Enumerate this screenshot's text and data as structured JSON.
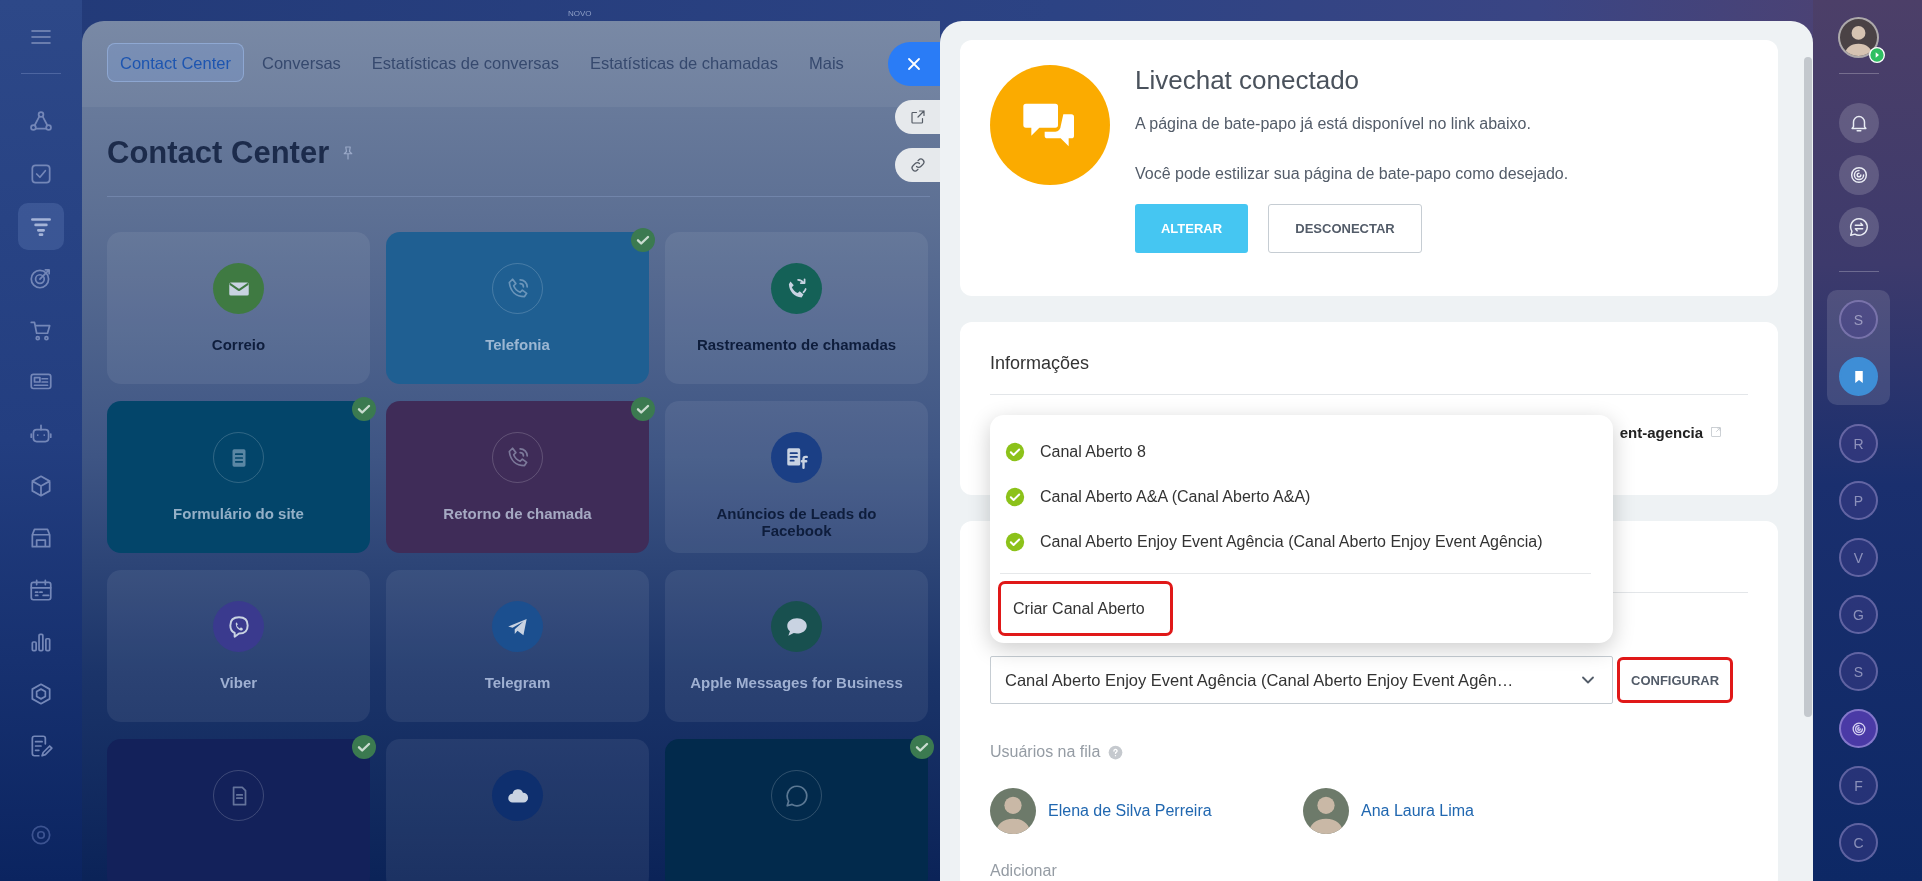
{
  "left_sidebar": {
    "items": [
      {
        "selected": false
      },
      {
        "selected": false
      },
      {
        "selected": true
      },
      {
        "selected": false
      },
      {
        "selected": false
      },
      {
        "selected": false
      },
      {
        "selected": false
      },
      {
        "selected": false
      },
      {
        "selected": false
      },
      {
        "selected": false
      },
      {
        "selected": false
      },
      {
        "selected": false
      },
      {
        "selected": false
      },
      {
        "selected": false
      }
    ]
  },
  "new_badge": "NOVO",
  "contact_center": {
    "tabs": [
      {
        "label": "Contact Center",
        "selected": true
      },
      {
        "label": "Conversas",
        "selected": false
      },
      {
        "label": "Estatísticas de conversas",
        "selected": false
      },
      {
        "label": "Estatísticas de chamadas",
        "selected": false
      },
      {
        "label": "Mais",
        "selected": false
      }
    ],
    "title": "Contact Center",
    "tiles": [
      {
        "label": "Correio",
        "kind": "plain",
        "checked": false,
        "color": "#3f7a42"
      },
      {
        "label": "Telefonia",
        "kind": "filled",
        "checked": true,
        "color": "#1f5f92"
      },
      {
        "label": "Rastreamento de chamadas",
        "kind": "plain",
        "checked": false,
        "color": "#146157"
      },
      {
        "label": "Formulário do site",
        "kind": "filled",
        "checked": true,
        "color": "#03456a"
      },
      {
        "label": "Retorno de chamada",
        "kind": "filled",
        "checked": true,
        "color": "#3f2c58"
      },
      {
        "label": "Anúncios de Leads do Facebook",
        "kind": "plain",
        "checked": false,
        "color": "#1b3f85"
      },
      {
        "label": "Viber",
        "kind": "plain",
        "checked": false,
        "color": "#3a3a8e"
      },
      {
        "label": "Telegram",
        "kind": "plain",
        "checked": false,
        "color": "#1b4f8f"
      },
      {
        "label": "Apple Messages for Business",
        "kind": "plain",
        "checked": false,
        "color": "#18504f"
      },
      {
        "kind": "filled",
        "checked": true,
        "color": "#13215a"
      },
      {
        "kind": "plain",
        "checked": false,
        "color": "#0e2f6e"
      },
      {
        "kind": "filled",
        "checked": true,
        "color": "#022a4c"
      }
    ]
  },
  "livechat": {
    "title": "Livechat conectado",
    "lines": [
      "A página de bate-papo já está disponível no link abaixo.",
      "Você pode estilizar sua página de bate-papo como desejado."
    ],
    "buttons": [
      {
        "label": "ALTERAR",
        "kind": "primary"
      },
      {
        "label": "DESCONECTAR",
        "kind": "secondary"
      }
    ]
  },
  "info": {
    "title": "Informações",
    "link_text": "ent-agencia"
  },
  "channel": {
    "select_value": "Canal Aberto Enjoy Event Agência (Canal Aberto Enjoy Event Agên…",
    "configure_button": {
      "label": "CONFIGURAR",
      "highlighted": true
    },
    "queue_label": "Usuários na fila",
    "users": [
      {
        "name": "Elena de Silva Perreira"
      },
      {
        "name": "Ana Laura Lima"
      }
    ],
    "add_label": "Adicionar"
  },
  "dropdown": {
    "options": [
      {
        "label": "Canal Aberto 8",
        "checked": true
      },
      {
        "label": "Canal Aberto A&A (Canal Aberto A&A)",
        "checked": true
      },
      {
        "label": "Canal Aberto Enjoy Event Agência (Canal Aberto Enjoy Event Agência)",
        "checked": true
      }
    ],
    "create": {
      "label": "Criar Canal Aberto",
      "highlighted": true
    }
  },
  "right_sidebar": {
    "pinned": [
      {
        "kind": "letter",
        "text": "S"
      },
      {
        "kind": "bookmark"
      }
    ],
    "chats": [
      {
        "kind": "letter",
        "text": "R"
      },
      {
        "kind": "letter",
        "text": "P"
      },
      {
        "kind": "letter",
        "text": "V"
      },
      {
        "kind": "letter",
        "text": "G"
      },
      {
        "kind": "letter",
        "text": "S"
      },
      {
        "kind": "logo"
      },
      {
        "kind": "letter",
        "text": "F"
      },
      {
        "kind": "letter",
        "text": "C"
      }
    ]
  }
}
